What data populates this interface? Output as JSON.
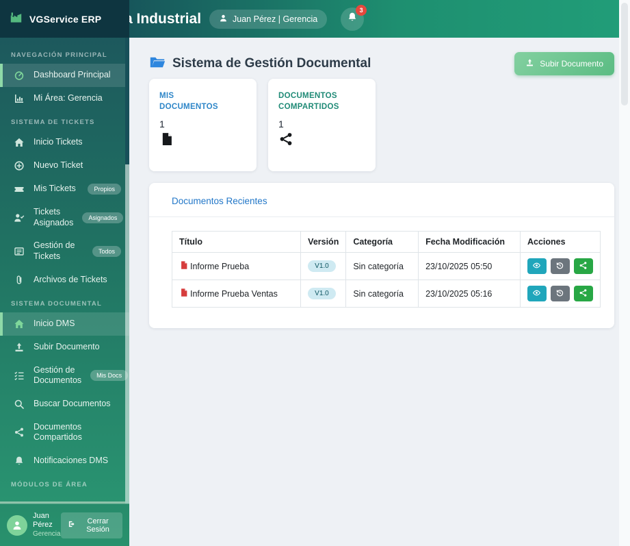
{
  "colors": {
    "sidebar_top": "#1c545c",
    "sidebar_bottom": "#2b9973",
    "logo_block": "#0e3540",
    "topbar_start": "#17565b",
    "topbar_end": "#219d78",
    "active_border": "#8fd9a8",
    "upload_green": "#6cc78b",
    "stat_blue": "#2e86c8",
    "stat_teal": "#1f8a76",
    "link_blue": "#2277c8",
    "badge_red": "#e5483d",
    "action_view": "#20a6bb",
    "action_history": "#6c757d",
    "action_share": "#28a745",
    "version_badge_bg": "#cfeaf2",
    "pdf_red": "#d63d3d"
  },
  "brand": {
    "name": "VGService ERP"
  },
  "topbar": {
    "title_clipped": "a Industrial",
    "user": "Juan Pérez | Gerencia",
    "notification_count": "3"
  },
  "sidebar": {
    "sections": [
      {
        "label": "NAVEGACIÓN PRINCIPAL"
      },
      {
        "label": "SISTEMA DE TICKETS"
      },
      {
        "label": "SISTEMA DOCUMENTAL"
      },
      {
        "label": "MÓDULOS DE ÁREA"
      }
    ],
    "items": [
      {
        "label": "Dashboard Principal",
        "icon": "gauge-icon",
        "active": true
      },
      {
        "label": "Mi Área: Gerencia",
        "icon": "chart-icon"
      },
      {
        "label": "Inicio Tickets",
        "icon": "home-icon"
      },
      {
        "label": "Nuevo Ticket",
        "icon": "plus-circle-icon"
      },
      {
        "label": "Mis Tickets",
        "icon": "ticket-icon",
        "badge": "Propios"
      },
      {
        "label": "Tickets Asignados",
        "icon": "user-check-icon",
        "badge": "Asignados"
      },
      {
        "label": "Gestión de Tickets",
        "icon": "list-icon",
        "badge": "Todos"
      },
      {
        "label": "Archivos de Tickets",
        "icon": "paperclip-icon"
      },
      {
        "label": "Inicio DMS",
        "icon": "home-icon",
        "active": true
      },
      {
        "label": "Subir Documento",
        "icon": "upload-icon"
      },
      {
        "label": "Gestión de Documentos",
        "icon": "checklist-icon",
        "badge": "Mis Docs"
      },
      {
        "label": "Buscar Documentos",
        "icon": "search-icon"
      },
      {
        "label": "Documentos Compartidos",
        "icon": "share-icon"
      },
      {
        "label": "Notificaciones DMS",
        "icon": "bell-icon"
      }
    ],
    "footer": {
      "name": "Juan Pérez",
      "role": "Gerencia",
      "logout": "Cerrar Sesión"
    }
  },
  "main": {
    "title": "Sistema de Gestión Documental",
    "upload_button": "Subir Documento",
    "cards": [
      {
        "title": "MIS DOCUMENTOS",
        "value": "1",
        "icon": "file-icon"
      },
      {
        "title": "DOCUMENTOS COMPARTIDOS",
        "value": "1",
        "icon": "share-icon"
      }
    ],
    "recent": {
      "title": "Documentos Recientes",
      "headers": [
        "Título",
        "Versión",
        "Categoría",
        "Fecha Modificación",
        "Acciones"
      ],
      "rows": [
        {
          "title": "Informe Prueba",
          "version": "V1.0",
          "category": "Sin categoría",
          "modified": "23/10/2025 05:50"
        },
        {
          "title": "Informe Prueba Ventas",
          "version": "V1.0",
          "category": "Sin categoría",
          "modified": "23/10/2025 05:16"
        }
      ]
    }
  }
}
